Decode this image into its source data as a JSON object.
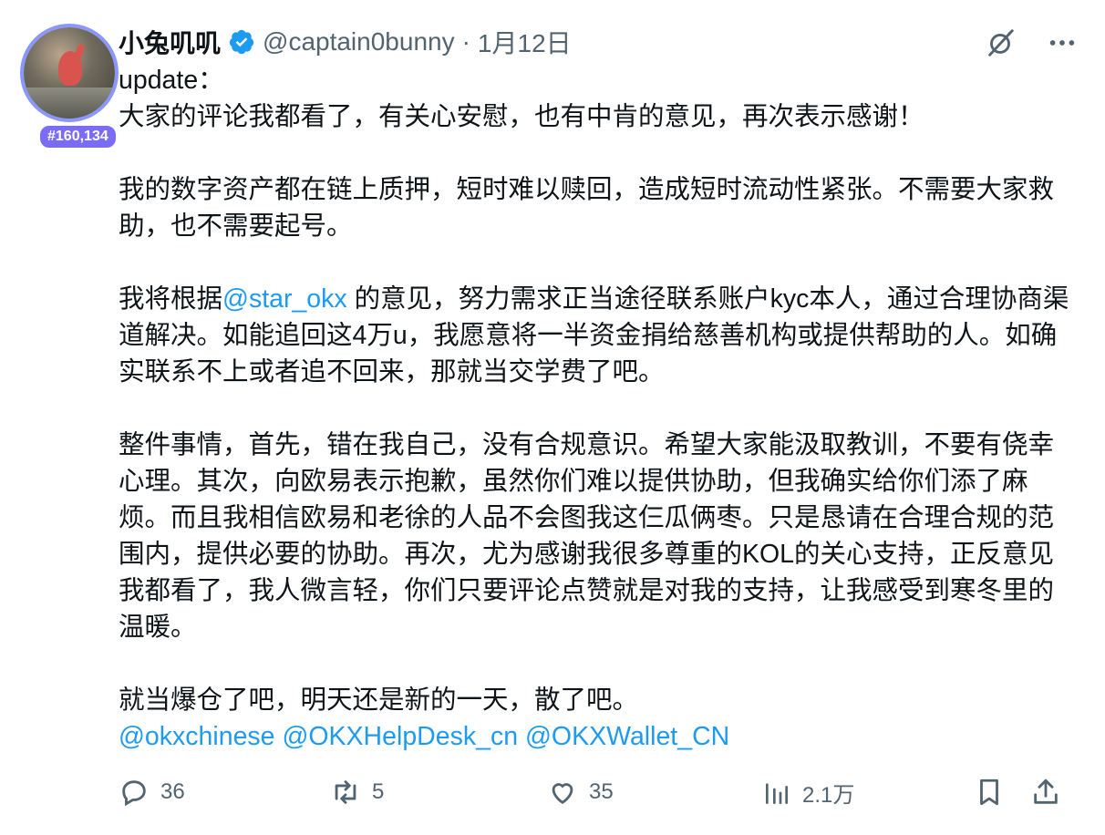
{
  "user": {
    "display_name": "小兔叽叽",
    "handle": "@captain0bunny",
    "separator": "·",
    "date": "1月12日",
    "badge": "#160,134"
  },
  "post": {
    "line1": "update：",
    "line2": "大家的评论我都看了，有关心安慰，也有中肯的意见，再次表示感谢！",
    "para2": "我的数字资产都在链上质押，短时难以赎回，造成短时流动性紧张。不需要大家救助，也不需要起号。",
    "para3_pre": "我将根据",
    "para3_mention": "@star_okx",
    "para3_post": " 的意见，努力需求正当途径联系账户kyc本人，通过合理协商渠道解决。如能追回这4万u，我愿意将一半资金捐给慈善机构或提供帮助的人。如确实联系不上或者追不回来，那就当交学费了吧。",
    "para4": "整件事情，首先，错在我自己，没有合规意识。希望大家能汲取教训，不要有侥幸心理。其次，向欧易表示抱歉，虽然你们难以提供协助，但我确实给你们添了麻烦。而且我相信欧易和老徐的人品不会图我这仨瓜俩枣。只是恳请在合理合规的范围内，提供必要的协助。再次，尤为感谢我很多尊重的KOL的关心支持，正反意见我都看了，我人微言轻，你们只要评论点赞就是对我的支持，让我感受到寒冬里的温暖。",
    "para5": "就当爆仓了吧，明天还是新的一天，散了吧。",
    "mentions": [
      "@okxchinese",
      "@OKXHelpDesk_cn",
      "@OKXWallet_CN"
    ]
  },
  "stats": {
    "replies": "36",
    "reposts": "5",
    "likes": "35",
    "views": "2.1万"
  },
  "colors": {
    "link": "#1d9bf0",
    "muted": "#536471",
    "verified": "#1d9bf0",
    "badge_bg": "#7b6cf6"
  }
}
